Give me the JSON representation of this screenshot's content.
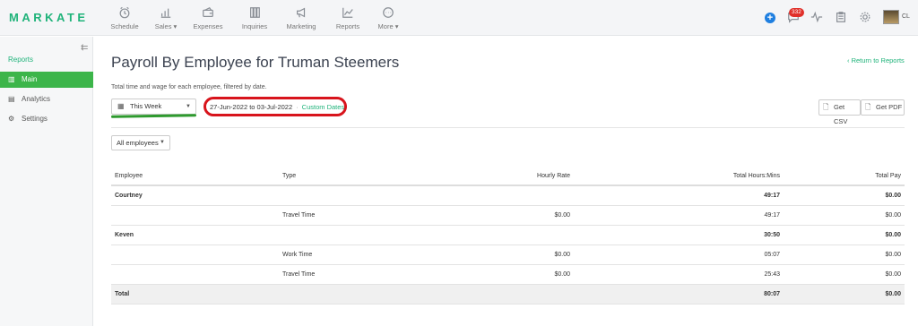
{
  "app": {
    "logo": "MARKATE"
  },
  "nav": {
    "items": [
      {
        "label": "Schedule",
        "icon": "clock-icon"
      },
      {
        "label": "Sales ▾",
        "icon": "bar-chart-icon"
      },
      {
        "label": "Expenses",
        "icon": "wallet-icon"
      },
      {
        "label": "Inquiries",
        "icon": "columns-icon"
      },
      {
        "label": "Marketing",
        "icon": "megaphone-icon"
      },
      {
        "label": "Reports",
        "icon": "line-chart-icon"
      },
      {
        "label": "More ▾",
        "icon": "ellipsis-icon"
      }
    ],
    "notification_count": "332",
    "user_initials": "CL"
  },
  "sidebar": {
    "title": "Reports",
    "items": [
      {
        "label": "Main",
        "icon": "bar-chart-icon",
        "active": true
      },
      {
        "label": "Analytics",
        "icon": "document-icon",
        "active": false
      },
      {
        "label": "Settings",
        "icon": "gear-icon",
        "active": false
      }
    ]
  },
  "page": {
    "title": "Payroll By Employee for Truman Steemers",
    "return_link": "Return to Reports",
    "subtitle": "Total time and wage for each employee, filtered by date.",
    "period_select": "This Week",
    "date_range": "27-Jun-2022 to 03-Jul-2022",
    "custom_dates": "Custom Dates",
    "get_csv": "Get CSV",
    "get_pdf": "Get PDF",
    "employee_filter": "All employees"
  },
  "table": {
    "headers": [
      "Employee",
      "Type",
      "Hourly Rate",
      "Total Hours:Mins",
      "Total Pay"
    ],
    "rows": [
      {
        "employee": "Courtney",
        "type": "",
        "rate": "",
        "hours": "49:17",
        "pay": "$0.00",
        "group": true
      },
      {
        "employee": "",
        "type": "Travel Time",
        "rate": "$0.00",
        "hours": "49:17",
        "pay": "$0.00",
        "group": false
      },
      {
        "employee": "Keven",
        "type": "",
        "rate": "",
        "hours": "30:50",
        "pay": "$0.00",
        "group": true
      },
      {
        "employee": "",
        "type": "Work Time",
        "rate": "$0.00",
        "hours": "05:07",
        "pay": "$0.00",
        "group": false
      },
      {
        "employee": "",
        "type": "Travel Time",
        "rate": "$0.00",
        "hours": "25:43",
        "pay": "$0.00",
        "group": false
      }
    ],
    "total": {
      "label": "Total",
      "hours": "80:07",
      "pay": "$0.00"
    }
  },
  "colors": {
    "brand_green": "#1fb37a",
    "active_green": "#3cb54a",
    "highlight_red": "#d8141c",
    "underline_green": "#2e9a2e"
  }
}
